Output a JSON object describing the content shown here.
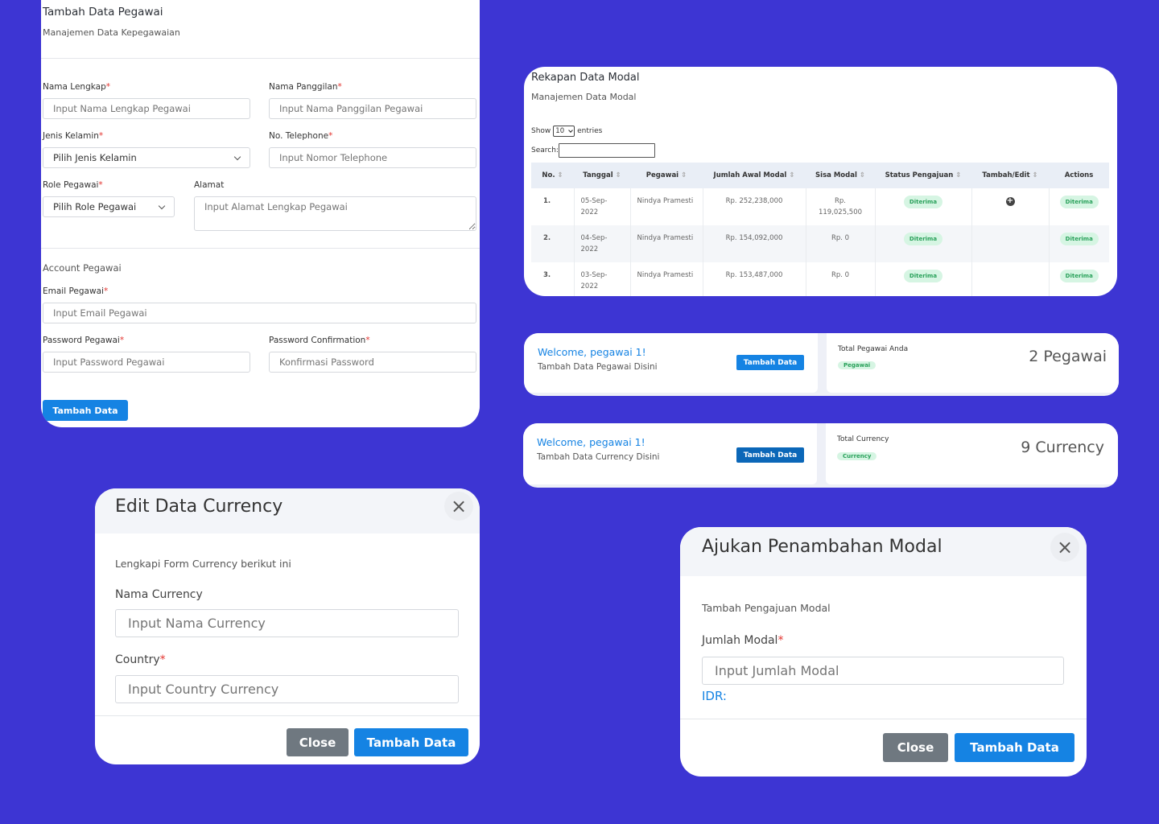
{
  "pegawai_form": {
    "title": "Tambah Data Pegawai",
    "subtitle": "Manajemen Data Kepegawaian",
    "nama_lengkap_label": "Nama Lengkap",
    "nama_lengkap_placeholder": "Input Nama Lengkap Pegawai",
    "nama_panggilan_label": "Nama Panggilan",
    "nama_panggilan_placeholder": "Input Nama Panggilan Pegawai",
    "jenis_kelamin_label": "Jenis Kelamin",
    "jenis_kelamin_value": "Pilih Jenis Kelamin",
    "telephone_label": "No. Telephone",
    "telephone_placeholder": "Input Nomor Telephone",
    "role_label": "Role Pegawai",
    "role_value": "Pilih Role Pegawai",
    "alamat_label": "Alamat",
    "alamat_placeholder": "Input Alamat Lengkap Pegawai",
    "account_section": "Account Pegawai",
    "email_label": "Email Pegawai",
    "email_placeholder": "Input Email Pegawai",
    "password_label": "Password Pegawai",
    "password_placeholder": "Input Password Pegawai",
    "password_confirm_label": "Password Confirmation",
    "password_confirm_placeholder": "Konfirmasi Password",
    "submit_label": "Tambah Data",
    "required_mark": "*"
  },
  "rekapan": {
    "title": "Rekapan Data Modal",
    "subtitle": "Manajemen Data Modal",
    "show_label": "Show",
    "show_value": "10",
    "entries_label": "entries",
    "search_label": "Search:",
    "columns": [
      "No.",
      "Tanggal",
      "Pegawai",
      "Jumlah Awal Modal",
      "Sisa Modal",
      "Status Pengajuan",
      "Tambah/Edit",
      "Actions"
    ],
    "rows": [
      {
        "no": "1.",
        "tanggal": "05-Sep-2022",
        "pegawai": "Nindya Pramesti",
        "jumlah": "Rp. 252,238,000",
        "sisa": "Rp. 119,025,500",
        "status": "Diterima",
        "action": "Diterima"
      },
      {
        "no": "2.",
        "tanggal": "04-Sep-2022",
        "pegawai": "Nindya Pramesti",
        "jumlah": "Rp. 154,092,000",
        "sisa": "Rp. 0",
        "status": "Diterima",
        "action": "Diterima"
      },
      {
        "no": "3.",
        "tanggal": "03-Sep-2022",
        "pegawai": "Nindya Pramesti",
        "jumlah": "Rp. 153,487,000",
        "sisa": "Rp. 0",
        "status": "Diterima",
        "action": "Diterima"
      }
    ]
  },
  "welcome_pegawai": {
    "title": "Welcome, pegawai 1!",
    "subtitle": "Tambah Data Pegawai Disini",
    "button": "Tambah Data",
    "stat_label": "Total Pegawai Anda",
    "stat_badge": "Pegawai",
    "stat_value": "2 Pegawai"
  },
  "welcome_currency": {
    "title": "Welcome, pegawai 1!",
    "subtitle": "Tambah Data Currency Disini",
    "button": "Tambah Data",
    "stat_label": "Total Currency",
    "stat_badge": "Currency",
    "stat_value": "9 Currency"
  },
  "edit_currency_modal": {
    "title": "Edit Data Currency",
    "close_glyph": "×",
    "description": "Lengkapi Form Currency berikut ini",
    "nama_label": "Nama Currency",
    "nama_placeholder": "Input Nama Currency",
    "country_label": "Country",
    "country_placeholder": "Input Country Currency",
    "close_button": "Close",
    "submit_button": "Tambah Data"
  },
  "modal_request_modal": {
    "title": "Ajukan Penambahan Modal",
    "close_glyph": "×",
    "description": "Tambah Pengajuan Modal",
    "jumlah_label": "Jumlah Modal",
    "jumlah_placeholder": "Input Jumlah Modal",
    "idr_label": "IDR:",
    "close_button": "Close",
    "submit_button": "Tambah Data"
  },
  "colors": {
    "background": "#3d35d3",
    "primary": "#1583e3",
    "success_badge": "#d6f5e3",
    "required": "#e3342f"
  }
}
